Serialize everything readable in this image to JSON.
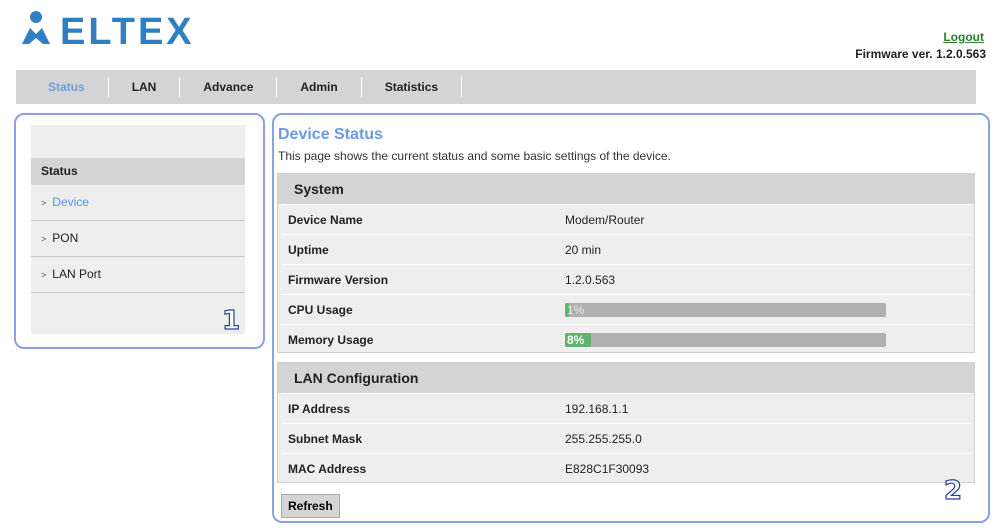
{
  "header": {
    "logo_text": "ELTEX",
    "logout_label": "Logout",
    "firmware_text": "Firmware ver. 1.2.0.563"
  },
  "nav": {
    "tabs": [
      {
        "label": "Status",
        "active": true
      },
      {
        "label": "LAN"
      },
      {
        "label": "Advance"
      },
      {
        "label": "Admin"
      },
      {
        "label": "Statistics"
      }
    ]
  },
  "sidebar": {
    "heading": "Status",
    "items": [
      {
        "label": "Device",
        "active": true
      },
      {
        "label": "PON"
      },
      {
        "label": "LAN Port"
      }
    ]
  },
  "annotations": {
    "sidebar_number": "1",
    "main_number": "2"
  },
  "main": {
    "title": "Device Status",
    "description": "This page shows the current status and some basic settings of the device.",
    "system": {
      "heading": "System",
      "rows": [
        {
          "label": "Device Name",
          "value": "Modem/Router"
        },
        {
          "label": "Uptime",
          "value": "20 min"
        },
        {
          "label": "Firmware Version",
          "value": "1.2.0.563"
        }
      ],
      "cpu": {
        "label": "CPU Usage",
        "value_text": "1%",
        "fraction": 0.01
      },
      "memory": {
        "label": "Memory Usage",
        "value_text": "8%",
        "fraction": 0.08
      }
    },
    "lan": {
      "heading": "LAN Configuration",
      "rows": [
        {
          "label": "IP Address",
          "value": "192.168.1.1"
        },
        {
          "label": "Subnet Mask",
          "value": "255.255.255.0"
        },
        {
          "label": "MAC Address",
          "value": "E828C1F30093"
        }
      ]
    },
    "refresh_label": "Refresh"
  },
  "colors": {
    "accent": "#6b9be0",
    "bar_fill": "#5fb36a",
    "annotation_border": "#8aa0e8",
    "logout": "#2e7d32"
  }
}
